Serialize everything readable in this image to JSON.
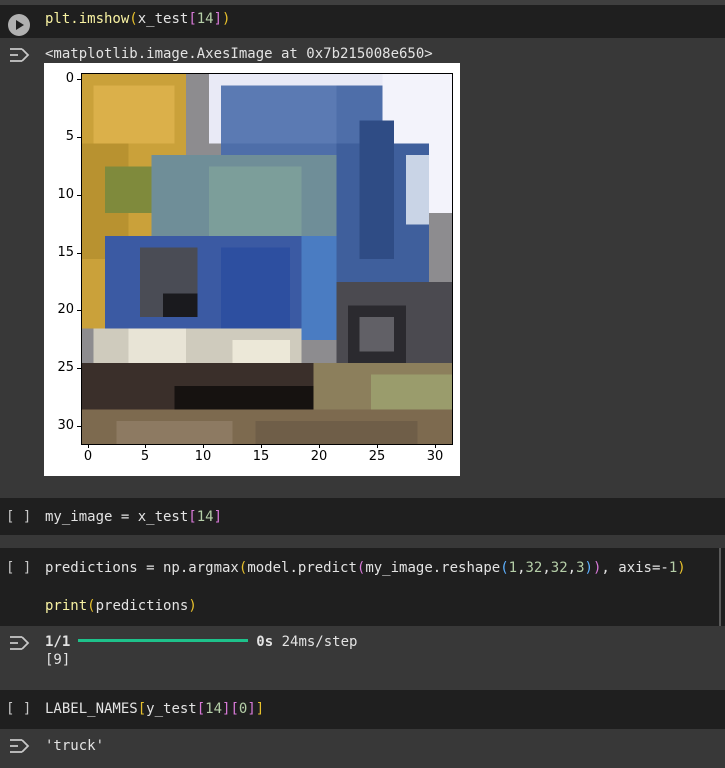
{
  "cells": [
    {
      "kind": "executed",
      "code": "plt.imshow(x_test[14])",
      "output": "<matplotlib.image.AxesImage at 0x7b215008e650>"
    },
    {
      "kind": "idle",
      "bracket": "[ ]",
      "code": "my_image = x_test[14]"
    },
    {
      "kind": "idle",
      "bracket": "[ ]",
      "code_line1": "predictions = np.argmax(model.predict(my_image.reshape(1,32,32,3)), axis=-1)",
      "code_line2": "print(predictions)",
      "progress": {
        "step": "1/1",
        "fraction": 1.0,
        "time": "0s",
        "rate": "24ms/step"
      },
      "output": "[9]"
    },
    {
      "kind": "idle",
      "bracket": "[ ]",
      "code": "LABEL_NAMES[y_test[14][0]]",
      "output": "'truck'"
    }
  ],
  "plot": {
    "y_ticks": [
      "0",
      "5",
      "10",
      "15",
      "20",
      "25",
      "30"
    ],
    "x_ticks": [
      "0",
      "5",
      "10",
      "15",
      "20",
      "25",
      "30"
    ],
    "image_description_colors": {
      "sky": "#f3f3fb",
      "truck_blue": "#3b5b9a",
      "tree_yellow": "#d6a93a",
      "ground": "#7d6a4f"
    }
  },
  "icons": {
    "run": "play-icon",
    "output": "output-toggle-icon"
  }
}
